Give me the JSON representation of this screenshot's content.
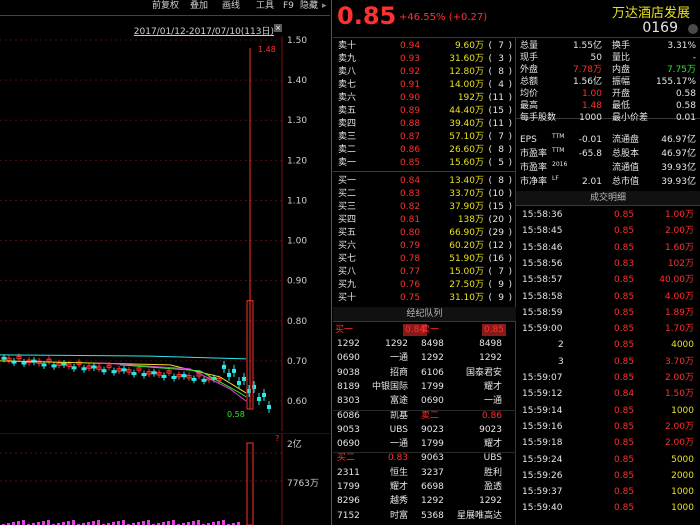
{
  "menu": [
    "前复权",
    "叠加",
    "画线",
    "工具",
    "F9",
    "隐藏"
  ],
  "date_range": "2017/01/12-2017/07/10(113日)",
  "chart": {
    "y_ticks": [
      "1.50",
      "1.40",
      "1.30",
      "1.20",
      "1.10",
      "1.00",
      "0.90",
      "0.80",
      "0.70",
      "0.60"
    ],
    "high_label": "1.48",
    "low_label": "0.58",
    "vol_ticks": [
      "2亿",
      "7763万"
    ]
  },
  "quote": {
    "price": "0.85",
    "change": "+46.55% (+0.27)",
    "name": "万达酒店发展",
    "code": "0169"
  },
  "asks": [
    {
      "label": "卖十",
      "price": "0.94",
      "vol": "9.60万",
      "n": "7"
    },
    {
      "label": "卖九",
      "price": "0.93",
      "vol": "31.60万",
      "n": "3"
    },
    {
      "label": "卖八",
      "price": "0.92",
      "vol": "12.80万",
      "n": "8"
    },
    {
      "label": "卖七",
      "price": "0.91",
      "vol": "14.00万",
      "n": "4"
    },
    {
      "label": "卖六",
      "price": "0.90",
      "vol": "192万",
      "n": "11"
    },
    {
      "label": "卖五",
      "price": "0.89",
      "vol": "44.40万",
      "n": "15"
    },
    {
      "label": "卖四",
      "price": "0.88",
      "vol": "39.40万",
      "n": "11"
    },
    {
      "label": "卖三",
      "price": "0.87",
      "vol": "57.10万",
      "n": "7"
    },
    {
      "label": "卖二",
      "price": "0.86",
      "vol": "26.60万",
      "n": "8"
    },
    {
      "label": "卖一",
      "price": "0.85",
      "vol": "15.60万",
      "n": "5"
    }
  ],
  "bids": [
    {
      "label": "买一",
      "price": "0.84",
      "vol": "13.40万",
      "n": "8"
    },
    {
      "label": "买二",
      "price": "0.83",
      "vol": "33.70万",
      "n": "10"
    },
    {
      "label": "买三",
      "price": "0.82",
      "vol": "37.90万",
      "n": "15"
    },
    {
      "label": "买四",
      "price": "0.81",
      "vol": "138万",
      "n": "20"
    },
    {
      "label": "买五",
      "price": "0.80",
      "vol": "66.90万",
      "n": "29"
    },
    {
      "label": "买六",
      "price": "0.79",
      "vol": "60.20万",
      "n": "12"
    },
    {
      "label": "买七",
      "price": "0.78",
      "vol": "51.90万",
      "n": "16"
    },
    {
      "label": "买八",
      "price": "0.77",
      "vol": "15.00万",
      "n": "7"
    },
    {
      "label": "买九",
      "price": "0.76",
      "vol": "27.50万",
      "n": "9"
    },
    {
      "label": "买十",
      "price": "0.75",
      "vol": "31.10万",
      "n": "9"
    }
  ],
  "stats": [
    {
      "k1": "总量",
      "v1": "1.55亿",
      "c1": "white",
      "k2": "换手",
      "v2": "3.31%",
      "c2": "white"
    },
    {
      "k1": "现手",
      "v1": "50",
      "c1": "white",
      "k2": "量比",
      "v2": "-",
      "c2": "white"
    },
    {
      "k1": "外盘",
      "v1": "7.78万",
      "c1": "red",
      "k2": "内盘",
      "v2": "7.75万",
      "c2": "green"
    },
    {
      "k1": "总额",
      "v1": "1.56亿",
      "c1": "white",
      "k2": "振幅",
      "v2": "155.17%",
      "c2": "white"
    },
    {
      "k1": "均价",
      "v1": "1.00",
      "c1": "red",
      "k2": "开盘",
      "v2": "0.58",
      "c2": "white"
    },
    {
      "k1": "最高",
      "v1": "1.48",
      "c1": "red",
      "k2": "最低",
      "v2": "0.58",
      "c2": "white"
    },
    {
      "k1": "每手股数",
      "v1": "1000",
      "c1": "white",
      "k2": "最小价差",
      "v2": "0.01",
      "c2": "white"
    }
  ],
  "fund": [
    {
      "k1": "EPS",
      "s1": "TTM",
      "v1": "-0.01",
      "k2": "流通盘",
      "v2": "46.97亿"
    },
    {
      "k1": "市盈率",
      "s1": "TTM",
      "v1": "-65.8",
      "k2": "总股本",
      "v2": "46.97亿"
    },
    {
      "k1": "市盈率",
      "s1": "2016",
      "v1": "",
      "k2": "流通值",
      "v2": "39.93亿"
    },
    {
      "k1": "市净率",
      "s1": "LF",
      "v1": "2.01",
      "k2": "总市值",
      "v2": "39.93亿"
    }
  ],
  "broker_title": "经纪队列",
  "broker_header": {
    "l1": "买一",
    "p1": "0.84",
    "l2": "卖一",
    "p2": "0.85"
  },
  "broker_rows": [
    {
      "a": "1292",
      "b": "1292",
      "c": "8498",
      "d": "8498"
    },
    {
      "a": "0690",
      "b": "一通",
      "c": "1292",
      "d": "1292"
    },
    {
      "a": "9038",
      "b": "招商",
      "c": "6106",
      "d": "国泰君安"
    },
    {
      "a": "8189",
      "b": "中银国际",
      "c": "1799",
      "d": "耀才"
    },
    {
      "a": "8303",
      "b": "富途",
      "c": "0690",
      "d": "一通"
    },
    {
      "a": "6086",
      "b": "凯基",
      "c": "卖二",
      "d": "0.86",
      "sep": true
    },
    {
      "a": "9053",
      "b": "UBS",
      "c": "9023",
      "d": "9023"
    },
    {
      "a": "0690",
      "b": "一通",
      "c": "1799",
      "d": "耀才"
    },
    {
      "a": "买二",
      "b": "0.83",
      "c": "9063",
      "d": "UBS",
      "sepb": true
    },
    {
      "a": "2311",
      "b": "恒生",
      "c": "3237",
      "d": "胜利"
    },
    {
      "a": "1799",
      "b": "耀才",
      "c": "6698",
      "d": "盈透"
    },
    {
      "a": "8296",
      "b": "越秀",
      "c": "1292",
      "d": "1292"
    },
    {
      "a": "7152",
      "b": "时富",
      "c": "5368",
      "d": "星展唯高达"
    }
  ],
  "trade_title": "成交明细",
  "trades": [
    {
      "t": "15:58:36",
      "p": "0.85",
      "v": "1.00万",
      "pc": "red",
      "vc": "red"
    },
    {
      "t": "15:58:45",
      "p": "0.85",
      "v": "2.00万",
      "pc": "red",
      "vc": "red"
    },
    {
      "t": "15:58:46",
      "p": "0.85",
      "v": "1.60万",
      "pc": "red",
      "vc": "red"
    },
    {
      "t": "15:58:56",
      "p": "0.83",
      "v": "102万",
      "pc": "red",
      "vc": "red"
    },
    {
      "t": "15:58:57",
      "p": "0.85",
      "v": "40.00万",
      "pc": "red",
      "vc": "red"
    },
    {
      "t": "15:58:58",
      "p": "0.85",
      "v": "4.00万",
      "pc": "red",
      "vc": "red"
    },
    {
      "t": "15:58:59",
      "p": "0.85",
      "v": "1.89万",
      "pc": "red",
      "vc": "red"
    },
    {
      "t": "15:59:00",
      "p": "0.85",
      "v": "1.70万",
      "pc": "red",
      "vc": "red"
    },
    {
      "t": "2",
      "p": "0.85",
      "v": "4000",
      "pc": "red",
      "vc": "yellow"
    },
    {
      "t": "3",
      "p": "0.85",
      "v": "3.70万",
      "pc": "red",
      "vc": "red"
    },
    {
      "t": "15:59:07",
      "p": "0.85",
      "v": "2.00万",
      "pc": "red",
      "vc": "red"
    },
    {
      "t": "15:59:12",
      "p": "0.84",
      "v": "1.50万",
      "pc": "red",
      "vc": "red"
    },
    {
      "t": "15:59:14",
      "p": "0.85",
      "v": "1000",
      "pc": "red",
      "vc": "yellow"
    },
    {
      "t": "15:59:16",
      "p": "0.85",
      "v": "2.00万",
      "pc": "red",
      "vc": "red"
    },
    {
      "t": "15:59:18",
      "p": "0.85",
      "v": "2.00万",
      "pc": "red",
      "vc": "red"
    },
    {
      "t": "15:59:24",
      "p": "0.85",
      "v": "5000",
      "pc": "red",
      "vc": "yellow"
    },
    {
      "t": "15:59:26",
      "p": "0.85",
      "v": "2000",
      "pc": "red",
      "vc": "yellow"
    },
    {
      "t": "15:59:37",
      "p": "0.85",
      "v": "1000",
      "pc": "red",
      "vc": "yellow"
    },
    {
      "t": "15:59:40",
      "p": "0.85",
      "v": "1000",
      "pc": "red",
      "vc": "yellow"
    }
  ]
}
